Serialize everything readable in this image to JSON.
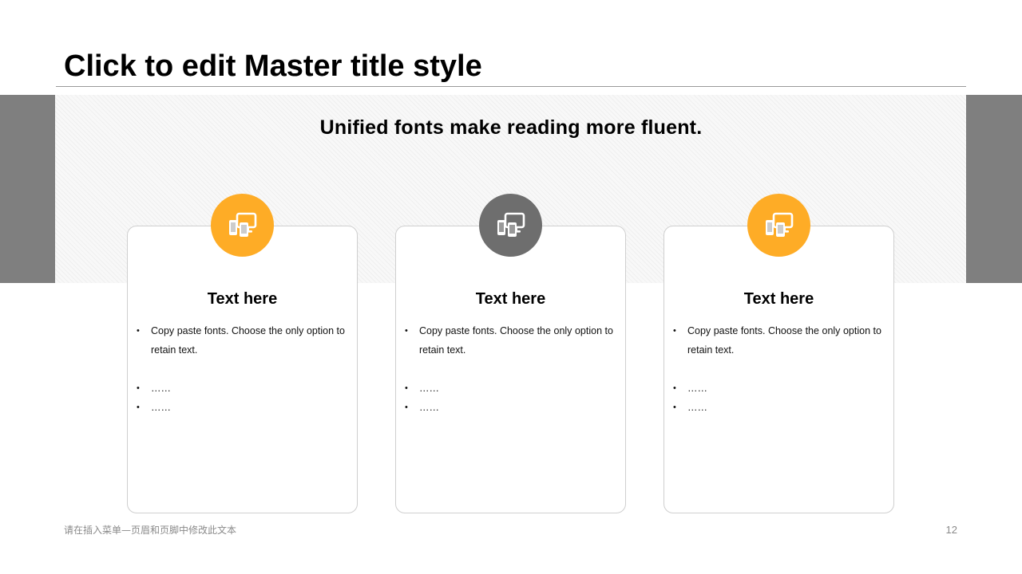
{
  "slide": {
    "title": "Click to edit Master title style",
    "subtitle": "Unified fonts make reading more fluent.",
    "footer": "请在插入菜单—页眉和页脚中修改此文本",
    "page_number": "12"
  },
  "colors": {
    "accent_orange": "#FEAC26",
    "accent_gray": "#6E6E6E",
    "band_gray": "#7F7F7F"
  },
  "cards": [
    {
      "icon": "devices-icon",
      "icon_color": "#FEAC26",
      "title": "Text here",
      "bullets": [
        "Copy paste fonts. Choose the only option to retain text.",
        "……",
        "……"
      ]
    },
    {
      "icon": "devices-icon",
      "icon_color": "#6E6E6E",
      "title": "Text here",
      "bullets": [
        "Copy paste fonts. Choose the only option to retain text.",
        "……",
        "……"
      ]
    },
    {
      "icon": "devices-icon",
      "icon_color": "#FEAC26",
      "title": "Text here",
      "bullets": [
        "Copy paste fonts. Choose the only option to retain text.",
        "……",
        "……"
      ]
    }
  ]
}
